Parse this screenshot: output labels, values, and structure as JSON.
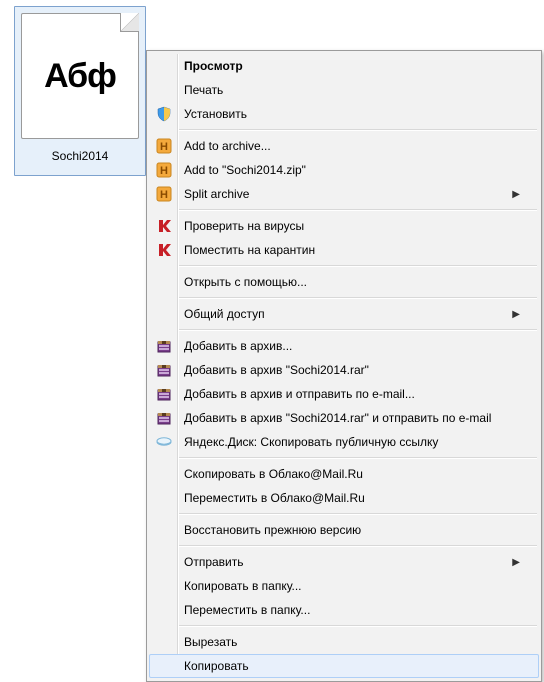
{
  "file": {
    "glyph": "Абф",
    "name": "Sochi2014"
  },
  "menu": {
    "preview": "Просмотр",
    "print": "Печать",
    "install": "Установить",
    "add_archive": "Add to archive...",
    "add_zip": "Add to \"Sochi2014.zip\"",
    "split_archive": "Split archive",
    "scan_virus": "Проверить на вирусы",
    "quarantine": "Поместить на карантин",
    "open_with": "Открыть с помощью...",
    "sharing": "Общий доступ",
    "rar_add": "Добавить в архив...",
    "rar_add_named": "Добавить в архив \"Sochi2014.rar\"",
    "rar_email": "Добавить в архив и отправить по e-mail...",
    "rar_named_email": "Добавить в архив \"Sochi2014.rar\" и отправить по e-mail",
    "yadisk": "Яндекс.Диск: Скопировать публичную ссылку",
    "mail_copy": "Скопировать в Облако@Mail.Ru",
    "mail_move": "Переместить в Облако@Mail.Ru",
    "restore": "Восстановить прежнюю версию",
    "send_to": "Отправить",
    "copy_to": "Копировать в папку...",
    "move_to": "Переместить в папку...",
    "cut": "Вырезать",
    "copy": "Копировать"
  }
}
